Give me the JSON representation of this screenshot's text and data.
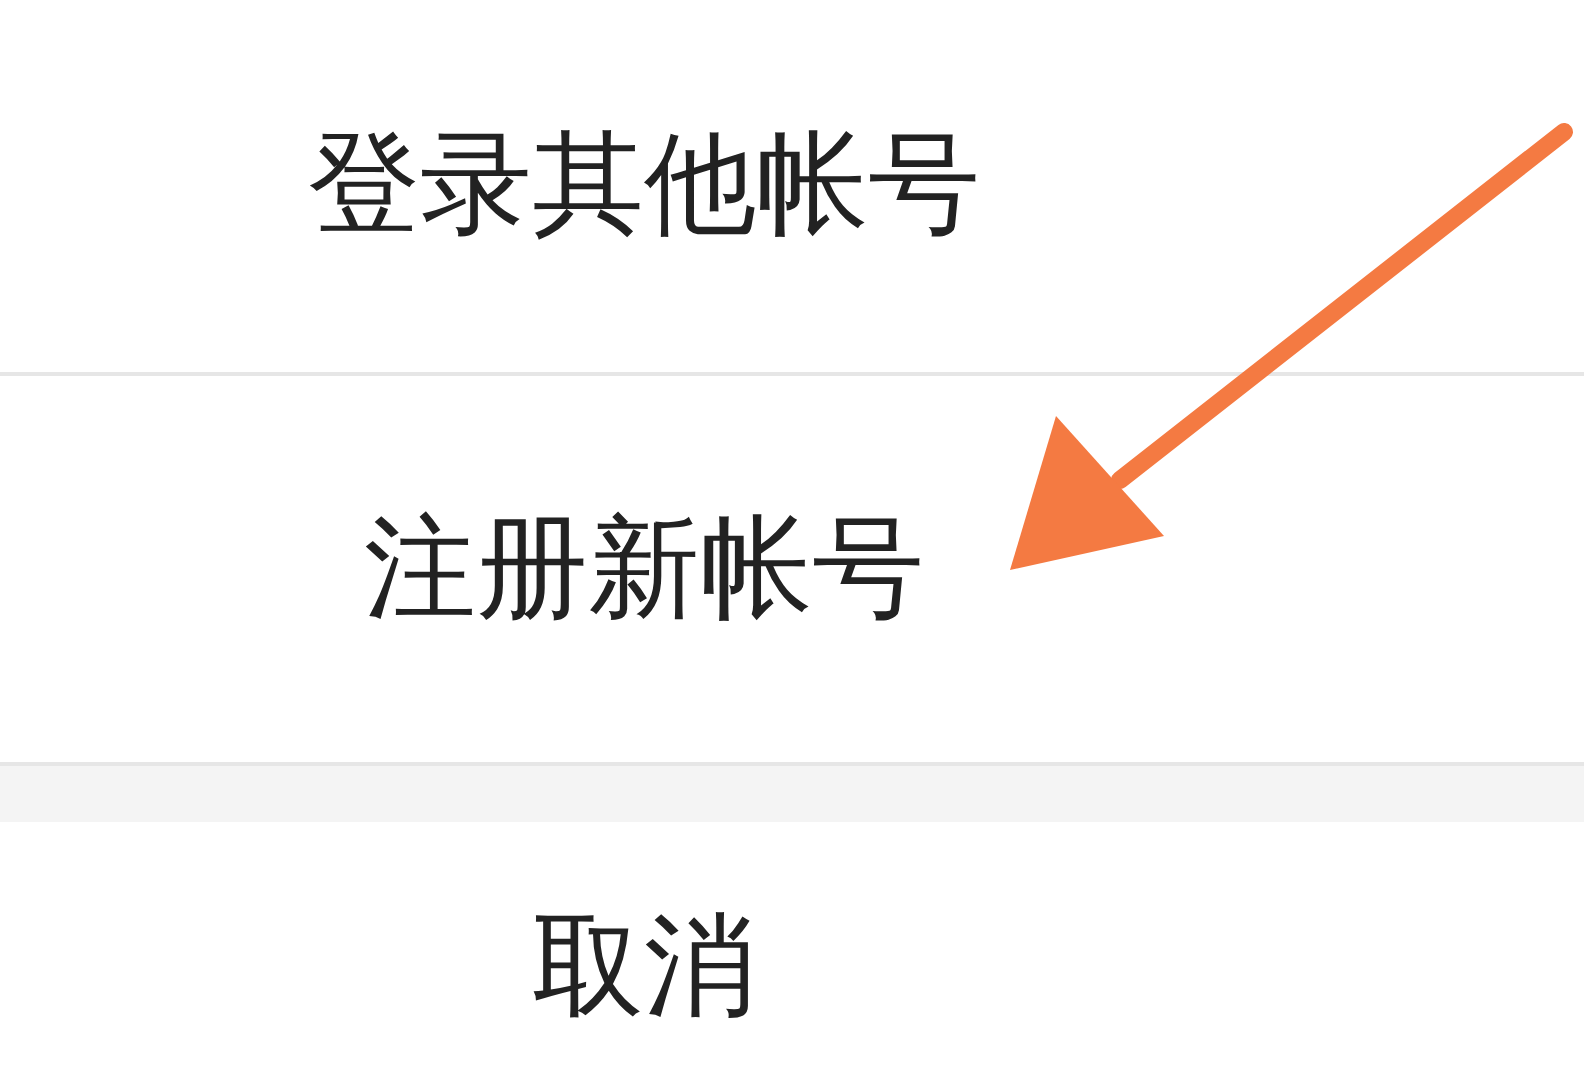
{
  "action_sheet": {
    "options": [
      {
        "label": "登录其他帐号"
      },
      {
        "label": "注册新帐号"
      }
    ],
    "cancel": {
      "label": "取消"
    }
  }
}
